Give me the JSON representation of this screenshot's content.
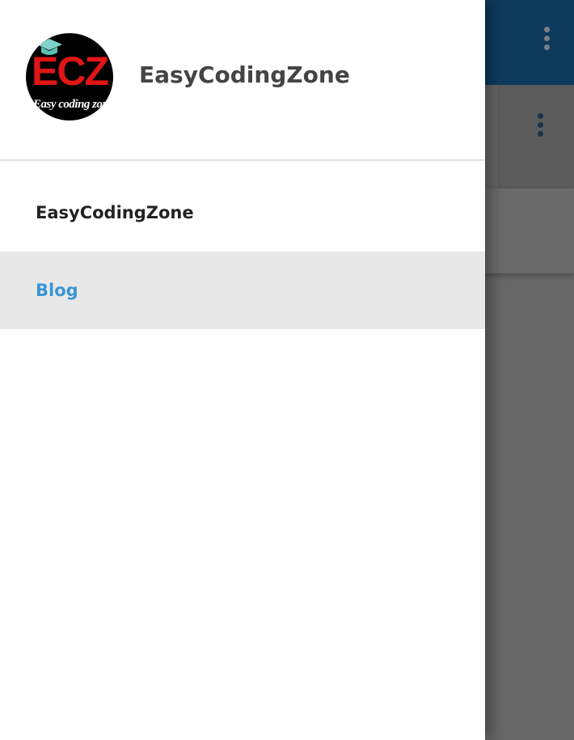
{
  "background_app": {
    "appbar_color": "#0e3a5c",
    "overflow_menu_icon": "more-vert-icon",
    "scrim_color": "#666666"
  },
  "drawer": {
    "logo": {
      "mark": "ECZ",
      "tagline": "Easy coding zone",
      "cap_icon": "graduation-cap-icon"
    },
    "title": "EasyCodingZone",
    "items": [
      {
        "label": "EasyCodingZone",
        "selected": false
      },
      {
        "label": "Blog",
        "selected": true
      }
    ],
    "accent_color": "#3b95d4",
    "selected_bg": "#e8e8e8"
  }
}
